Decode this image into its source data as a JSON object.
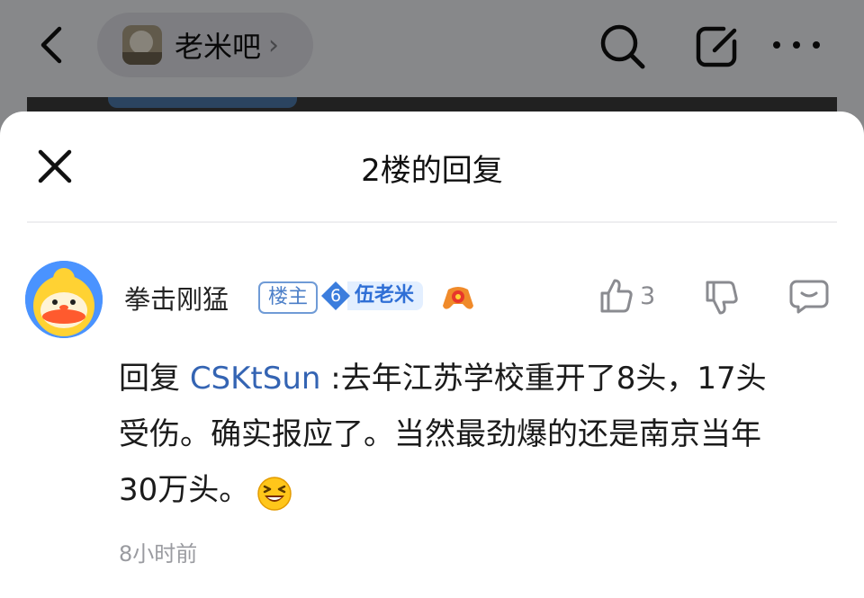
{
  "header": {
    "forum_name": "老米吧",
    "chevron": "›"
  },
  "sheet": {
    "title": "2楼的回复"
  },
  "post": {
    "username": "拳击刚猛",
    "op_badge": "楼主",
    "level_number": "6",
    "level_title": "伍老米",
    "like_count": "3",
    "reply_prefix": "回复 ",
    "mention": "CSKtSun",
    "text_line1": " :去年江苏学校重开了8头，17头",
    "text_line2": "受伤。确实报应了。当然最劲爆的还是南京当年",
    "text_line3": "30万头。",
    "time": "8小时前"
  },
  "colors": {
    "mention": "#3464b3",
    "level_badge": "#3b7ddd",
    "op_badge": "#4c7fc8"
  },
  "icons": [
    "back-arrow-icon",
    "search-icon",
    "edit-icon",
    "more-icon",
    "close-icon",
    "thumbs-up-icon",
    "thumbs-down-icon",
    "reply-comment-icon",
    "gamepad-icon",
    "laughing-emoji-icon"
  ]
}
